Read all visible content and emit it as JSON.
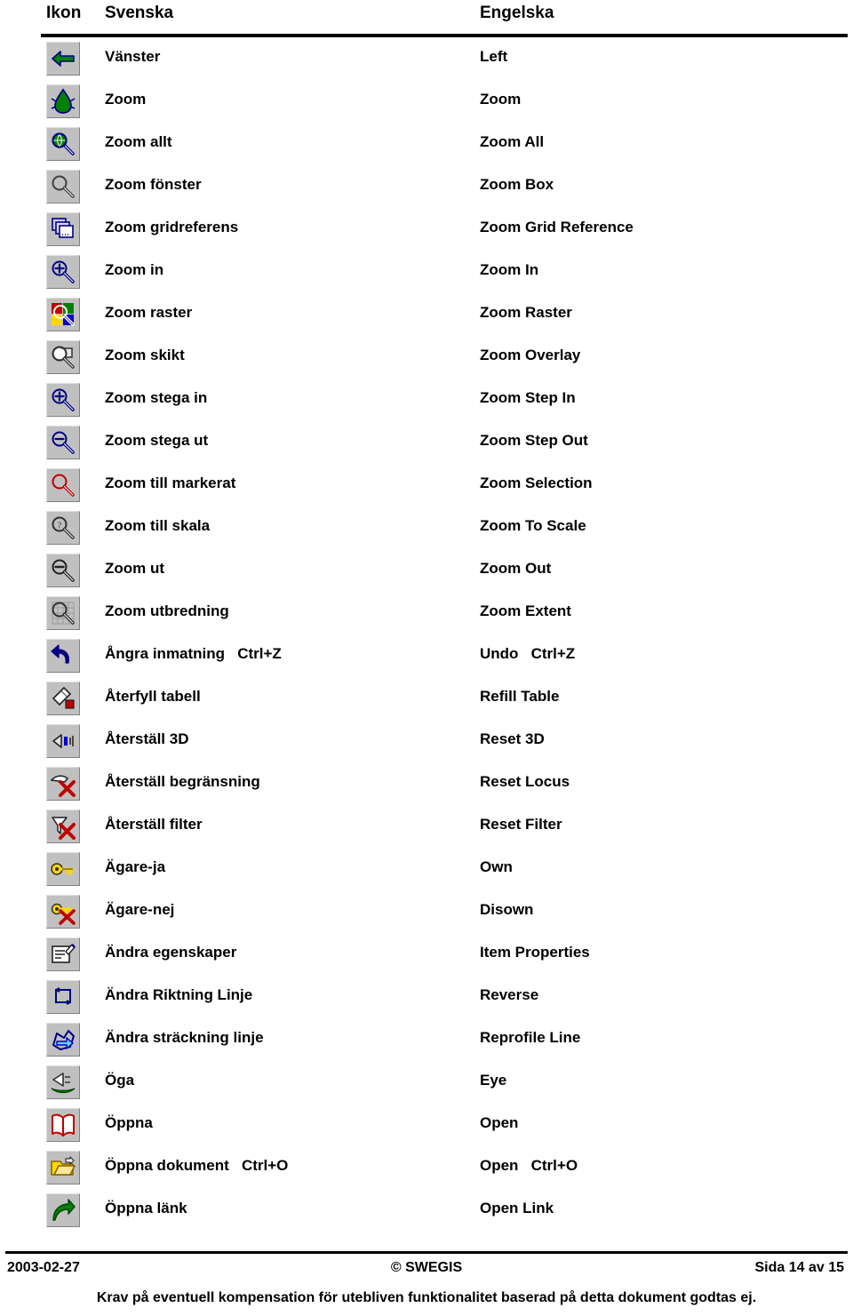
{
  "header": {
    "col_icon": "Ikon",
    "col_swedish": "Svenska",
    "col_english": "Engelska"
  },
  "rows": [
    {
      "icon": "arrow-left-icon",
      "swedish": "Vänster",
      "english": "Left"
    },
    {
      "icon": "zoom-tree-icon",
      "swedish": "Zoom",
      "english": "Zoom"
    },
    {
      "icon": "zoom-globe-icon",
      "swedish": "Zoom allt",
      "english": "Zoom All"
    },
    {
      "icon": "zoom-box-icon",
      "swedish": "Zoom fönster",
      "english": "Zoom Box"
    },
    {
      "icon": "zoom-grid-reference-icon",
      "swedish": "Zoom gridreferens",
      "english": "Zoom Grid Reference"
    },
    {
      "icon": "zoom-in-icon",
      "swedish": "Zoom in",
      "english": "Zoom In"
    },
    {
      "icon": "zoom-raster-icon",
      "swedish": "Zoom raster",
      "english": "Zoom Raster"
    },
    {
      "icon": "zoom-overlay-icon",
      "swedish": "Zoom skikt",
      "english": "Zoom Overlay"
    },
    {
      "icon": "zoom-step-in-icon",
      "swedish": "Zoom stega in",
      "english": "Zoom Step In"
    },
    {
      "icon": "zoom-step-out-icon",
      "swedish": "Zoom stega ut",
      "english": "Zoom Step Out"
    },
    {
      "icon": "zoom-selection-icon",
      "swedish": "Zoom till markerat",
      "english": "Zoom Selection"
    },
    {
      "icon": "zoom-to-scale-icon",
      "swedish": "Zoom till skala",
      "english": "Zoom To Scale"
    },
    {
      "icon": "zoom-out-icon",
      "swedish": "Zoom ut",
      "english": "Zoom Out"
    },
    {
      "icon": "zoom-extent-icon",
      "swedish": "Zoom utbredning",
      "english": "Zoom Extent"
    },
    {
      "icon": "undo-icon",
      "swedish": "Ångra inmatning   Ctrl+Z",
      "english": "Undo   Ctrl+Z"
    },
    {
      "icon": "refill-table-icon",
      "swedish": "Återfyll tabell",
      "english": "Refill Table"
    },
    {
      "icon": "reset-3d-icon",
      "swedish": "Återställ 3D",
      "english": "Reset 3D"
    },
    {
      "icon": "reset-locus-icon",
      "swedish": "Återställ begränsning",
      "english": "Reset Locus"
    },
    {
      "icon": "reset-filter-icon",
      "swedish": "Återställ filter",
      "english": "Reset Filter"
    },
    {
      "icon": "own-key-icon",
      "swedish": "Ägare-ja",
      "english": "Own"
    },
    {
      "icon": "disown-key-icon",
      "swedish": "Ägare-nej",
      "english": "Disown"
    },
    {
      "icon": "item-properties-icon",
      "swedish": "Ändra egenskaper",
      "english": "Item Properties"
    },
    {
      "icon": "reverse-direction-icon",
      "swedish": "Ändra Riktning Linje",
      "english": "Reverse"
    },
    {
      "icon": "reprofile-line-icon",
      "swedish": "Ändra sträckning linje",
      "english": "Reprofile Line"
    },
    {
      "icon": "eye-icon",
      "swedish": "Öga",
      "english": "Eye"
    },
    {
      "icon": "open-book-icon",
      "swedish": "Öppna",
      "english": "Open"
    },
    {
      "icon": "open-folder-icon",
      "swedish": "Öppna dokument   Ctrl+O",
      "english": "Open   Ctrl+O"
    },
    {
      "icon": "open-link-icon",
      "swedish": "Öppna länk",
      "english": "Open Link"
    }
  ],
  "footer": {
    "date": "2003-02-27",
    "copyright": "© SWEGIS",
    "page": "Sida 14 av 15",
    "note": "Krav på eventuell kompensation för utebliven funktionalitet baserad på detta dokument godtas ej."
  },
  "colors": {
    "text": "#000000",
    "page_background": "#ffffff",
    "button_face": "#c0c0c0",
    "icon_green": "#008000",
    "icon_navy": "#000080",
    "icon_red": "#c00000",
    "icon_yellow": "#ffd700",
    "icon_blue": "#0000cd"
  }
}
